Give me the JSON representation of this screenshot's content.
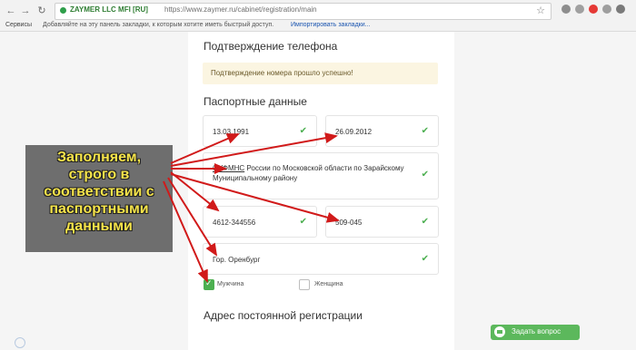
{
  "browser": {
    "secure_label": "ZAYMER LLC MFI [RU]",
    "url": "https://www.zaymer.ru/cabinet/registration/main",
    "bookmarks_apps": "Сервисы",
    "bookmarks_hint": "Добавляйте на эту панель закладки, к которым хотите иметь быстрый доступ.",
    "bookmarks_import": "Импортировать закладки..."
  },
  "phone": {
    "heading": "Подтверждение телефона",
    "notice": "Подтверждение номера прошло успешно!"
  },
  "passport": {
    "heading": "Паспортные данные",
    "birth_date": "13.03.1991",
    "issue_date": "26.09.2012",
    "issued_by_abbr": "ОУФМНС",
    "issued_by_rest": " России по Московской области по Зарайскому Муниципальному району",
    "series_number": "4612-344556",
    "division_code": "509-045",
    "birth_place": "Гор. Оренбург",
    "gender_male": "Мужчина",
    "gender_female": "Женщина",
    "selected_gender": "male"
  },
  "address": {
    "heading": "Адрес постоянной регистрации"
  },
  "callout": {
    "lines": [
      "Заполняем,",
      "строго в",
      "соответствии с",
      "паспортными",
      "данными"
    ]
  },
  "chat": {
    "label": "Задать вопрос"
  },
  "colors": {
    "accent_green": "#4caf50",
    "notice_bg": "#fbf5e1",
    "callout_text": "#f6e44a",
    "arrow_red": "#d11a1a"
  }
}
